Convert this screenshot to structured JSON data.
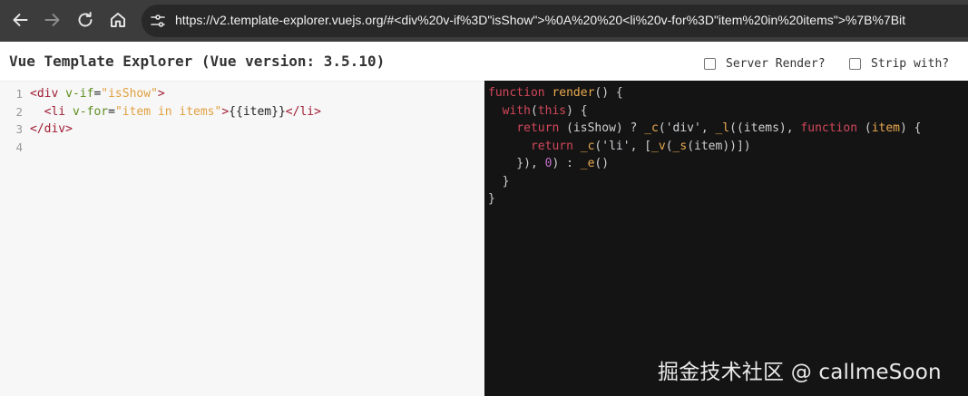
{
  "browser": {
    "url": "https://v2.template-explorer.vuejs.org/#<div%20v-if%3D\"isShow\">%0A%20%20<li%20v-for%3D\"item%20in%20items\">%7B%7Bit"
  },
  "header": {
    "title": "Vue Template Explorer (Vue version: 3.5.10)",
    "options": [
      {
        "label": "Server Render?",
        "checked": false
      },
      {
        "label": "Strip with?",
        "checked": false
      }
    ]
  },
  "editor": {
    "line_numbers": [
      "1",
      "2",
      "3",
      "4"
    ],
    "lines": [
      [
        [
          "tag",
          "<div "
        ],
        [
          "attr",
          "v-if"
        ],
        [
          "plain",
          "="
        ],
        [
          "str",
          "\"isShow\""
        ],
        [
          "tag",
          ">"
        ]
      ],
      [
        [
          "plain",
          "  "
        ],
        [
          "tag",
          "<li "
        ],
        [
          "attr",
          "v-for"
        ],
        [
          "plain",
          "="
        ],
        [
          "str",
          "\"item in items\""
        ],
        [
          "tag",
          ">"
        ],
        [
          "plain",
          "{{item}}"
        ],
        [
          "tag",
          "</li>"
        ]
      ],
      [
        [
          "tag",
          "</div>"
        ]
      ],
      []
    ]
  },
  "output": {
    "lines": [
      [
        [
          "kw",
          "function "
        ],
        [
          "fn",
          "render"
        ],
        [
          "id",
          "() {"
        ]
      ],
      [
        [
          "id",
          "  "
        ],
        [
          "kw",
          "with"
        ],
        [
          "id",
          "("
        ],
        [
          "kw",
          "this"
        ],
        [
          "id",
          ") {"
        ]
      ],
      [
        [
          "id",
          "    "
        ],
        [
          "kw",
          "return "
        ],
        [
          "id",
          "(isShow) ? "
        ],
        [
          "fn",
          "_c"
        ],
        [
          "id",
          "("
        ],
        [
          "os",
          "'div'"
        ],
        [
          "id",
          ", "
        ],
        [
          "fn",
          "_l"
        ],
        [
          "id",
          "((items), "
        ],
        [
          "kw",
          "function "
        ],
        [
          "id",
          "("
        ],
        [
          "pm",
          "item"
        ],
        [
          "id",
          ") {"
        ]
      ],
      [
        [
          "id",
          "      "
        ],
        [
          "kw",
          "return "
        ],
        [
          "fn",
          "_c"
        ],
        [
          "id",
          "("
        ],
        [
          "os",
          "'li'"
        ],
        [
          "id",
          ", ["
        ],
        [
          "fn",
          "_v"
        ],
        [
          "id",
          "("
        ],
        [
          "fn",
          "_s"
        ],
        [
          "id",
          "(item))])"
        ]
      ],
      [
        [
          "id",
          "    }), "
        ],
        [
          "num",
          "0"
        ],
        [
          "id",
          ") : "
        ],
        [
          "fn",
          "_e"
        ],
        [
          "id",
          "()"
        ]
      ],
      [
        [
          "id",
          "  }"
        ]
      ],
      [
        [
          "id",
          "}"
        ]
      ]
    ]
  },
  "watermark": "掘金技术社区 @ callmeSoon",
  "colors": {
    "chrome": "#3c3c3c",
    "editor_bg": "#f7f7f7",
    "output_bg": "#141414",
    "keyword": "#d2475a",
    "function": "#e8a950"
  }
}
